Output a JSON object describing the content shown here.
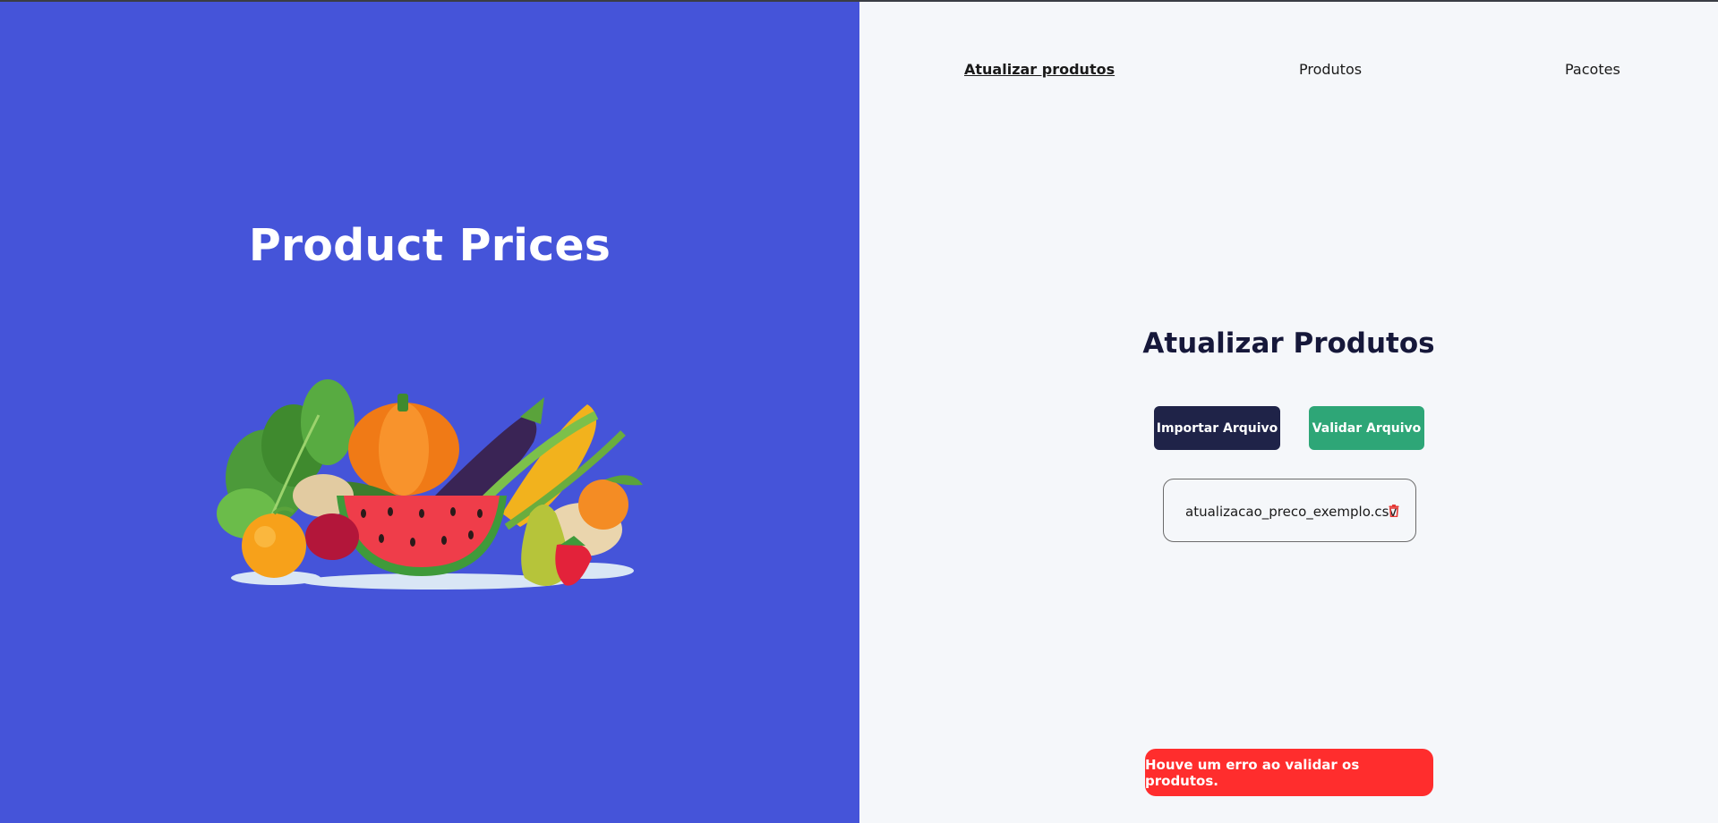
{
  "hero": {
    "title": "Product Prices"
  },
  "nav": {
    "items": [
      {
        "label": "Atualizar produtos",
        "active": true
      },
      {
        "label": "Produtos",
        "active": false
      },
      {
        "label": "Pacotes",
        "active": false
      }
    ]
  },
  "main": {
    "title": "Atualizar Produtos",
    "import_label": "Importar Arquivo",
    "validate_label": "Validar Arquivo",
    "file_name": "atualizacao_preco_exemplo.csv"
  },
  "toast": {
    "message": "Houve um erro ao validar os produtos."
  },
  "colors": {
    "hero_bg": "#4554d9",
    "import_btn": "#1f2348",
    "validate_btn": "#2ea677",
    "error": "#ff2d2d",
    "delete_icon": "#e53935"
  }
}
